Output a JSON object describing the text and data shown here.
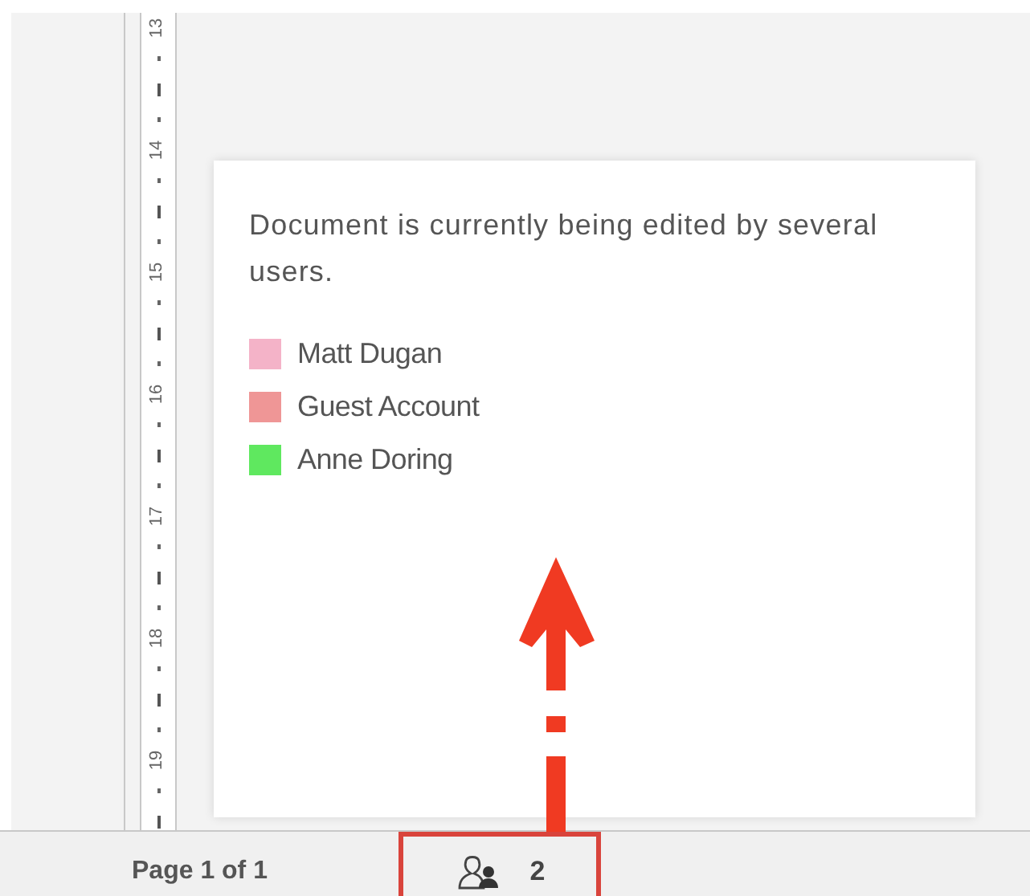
{
  "ruler": {
    "numbers": [
      "13",
      "14",
      "15",
      "16",
      "17",
      "18",
      "19"
    ]
  },
  "popup": {
    "message": "Document is currently being edited by several users.",
    "users": [
      {
        "name": "Matt Dugan",
        "color": "#f4b3c8"
      },
      {
        "name": "Guest Account",
        "color": "#ef9696"
      },
      {
        "name": "Anne Doring",
        "color": "#5fe85f"
      }
    ]
  },
  "status_bar": {
    "page": "Page 1 of 1",
    "users_count": "2"
  }
}
